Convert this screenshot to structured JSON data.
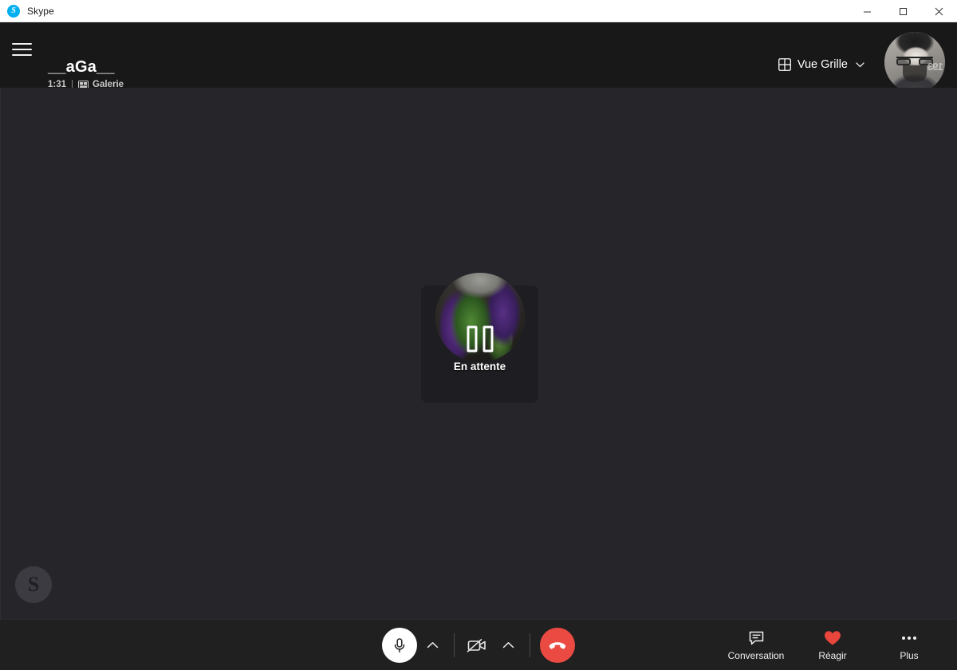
{
  "window": {
    "app_title": "Skype",
    "app_icon": "skype-icon",
    "controls": {
      "minimize": "minimize-icon",
      "maximize": "maximize-icon",
      "close": "close-icon"
    }
  },
  "header": {
    "menu_icon": "hamburger-menu-icon",
    "call_title": "__aGa__",
    "duration": "1:31",
    "separator": "|",
    "layout_icon": "gallery-icon",
    "layout_label": "Galerie",
    "view_switch": {
      "icon": "grid-view-icon",
      "label": "Vue Grille",
      "chevron": "chevron-down-icon"
    },
    "self_avatar": "user-avatar"
  },
  "stage": {
    "participant": {
      "status_label": "En attente",
      "status_icon": "pause-icon",
      "avatar": "participant-avatar"
    },
    "watermark": {
      "letter": "S",
      "icon": "skype-watermark-icon"
    }
  },
  "controls": {
    "microphone": {
      "icon": "microphone-icon",
      "state": "on"
    },
    "mic_menu_icon": "chevron-up-icon",
    "camera": {
      "icon": "camera-off-icon",
      "state": "off"
    },
    "camera_menu_icon": "chevron-up-icon",
    "hangup": {
      "icon": "hangup-phone-icon"
    },
    "right_items": [
      {
        "icon": "chat-bubble-icon",
        "label": "Conversation"
      },
      {
        "icon": "heart-icon",
        "label": "Réagir"
      },
      {
        "icon": "more-horizontal-icon",
        "label": "Plus"
      }
    ]
  },
  "colors": {
    "accent": "#00aff0",
    "hangup": "#eb4a42",
    "reaction_heart": "#e8453c",
    "stage_bg": "#26262a",
    "header_bg": "#181818",
    "controlbar_bg": "#202020",
    "tile_bg": "#1e1e22"
  }
}
